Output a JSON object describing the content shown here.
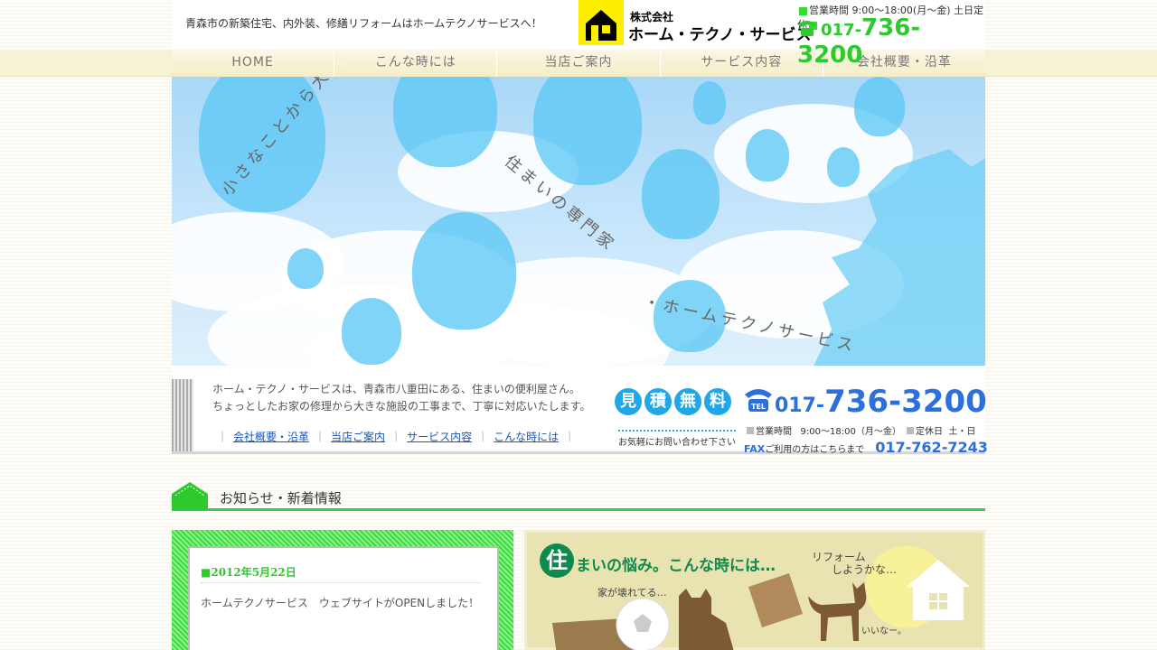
{
  "header": {
    "tagline": "青森市の新築住宅、内外装、修繕リフォームはホームテクノサービスへ！",
    "company_prefix": "株式会社",
    "company_name": "ホーム・テクノ・サービス",
    "hours": "営業時間 9:00〜18:00(月〜金) 土日定休",
    "tel_prefix": "017-",
    "tel_number": "736-3200"
  },
  "nav": {
    "items": [
      {
        "label": "HOME"
      },
      {
        "label": "こんな時には"
      },
      {
        "label": "当店ご案内"
      },
      {
        "label": "サービス内容"
      },
      {
        "label": "会社概要・沿革"
      }
    ]
  },
  "hero": {
    "catch_part1": "小さなことから大きなことまで。",
    "catch_part2": "住まいの専門家",
    "catch_part3": "・ホームテクノサービス"
  },
  "intro": {
    "line1": "ホーム・テクノ・サービスは、青森市八重田にある、住まいの便利屋さん。",
    "line2": "ちょっとしたお家の修理から大きな施設の工事まで、丁寧に対応いたします。",
    "links": [
      "会社概要・沿革",
      "当店ご案内",
      "サービス内容",
      "こんな時には"
    ],
    "estimate_chars": [
      "見",
      "積",
      "無",
      "料"
    ],
    "estimate_sub": "お気軽にお問い合わせ下さい",
    "tel_prefix": "017-",
    "tel_number": "736-3200",
    "hours_label": "営業時間",
    "hours_value": "9:00〜18:00（月〜金）",
    "holiday_label": "定休日",
    "holiday_value": "土・日",
    "fax_label": "FAX",
    "fax_text": "ご利用の方はこちらまで",
    "fax_number": "017-762-7243"
  },
  "news": {
    "heading": "お知らせ・新着情報",
    "date": "■2012年5月22日",
    "body": "ホームテクノサービス　ウェブサイトがOPENしました！"
  },
  "banner": {
    "badge": "住",
    "title": "まいの悩み。こんな時には…",
    "reform_line1": "リフォーム",
    "reform_line2": "しようかな…",
    "broken": "家が壊れてる…",
    "nice": "いいなー。"
  },
  "colors": {
    "accent_green": "#2ec92e",
    "tel_blue": "#2d6fdc",
    "nav_bg": "#f7f2d4",
    "estimate_blue": "#1fa7e8"
  }
}
